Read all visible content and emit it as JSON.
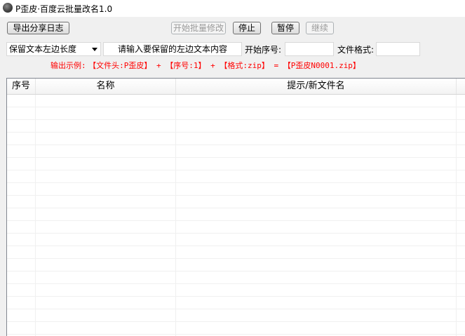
{
  "window": {
    "title": "P歪皮·百度云批量改名1.0",
    "icon": "app-logo-icon"
  },
  "toolbar": {
    "export_log": "导出分享日志",
    "start_batch": "开始批量修改",
    "stop": "停止",
    "pause": "暂停",
    "resume": "继续"
  },
  "options": {
    "mode_select": {
      "selected": "保留文本左边长度"
    },
    "keep_text": {
      "placeholder": "请输入要保留的左边文本内容",
      "value": ""
    },
    "start_number": {
      "label": "开始序号:",
      "value": ""
    },
    "file_format": {
      "label": "文件格式:",
      "value": ""
    }
  },
  "example": {
    "prefix": "输出示例:",
    "text": "【文件头:P歪皮】 + 【序号:1】 + 【格式:zip】 = 【P歪皮N0001.zip】",
    "color": "#ff0000"
  },
  "table": {
    "columns": [
      "序号",
      "名称",
      "提示/新文件名"
    ],
    "rows": []
  }
}
